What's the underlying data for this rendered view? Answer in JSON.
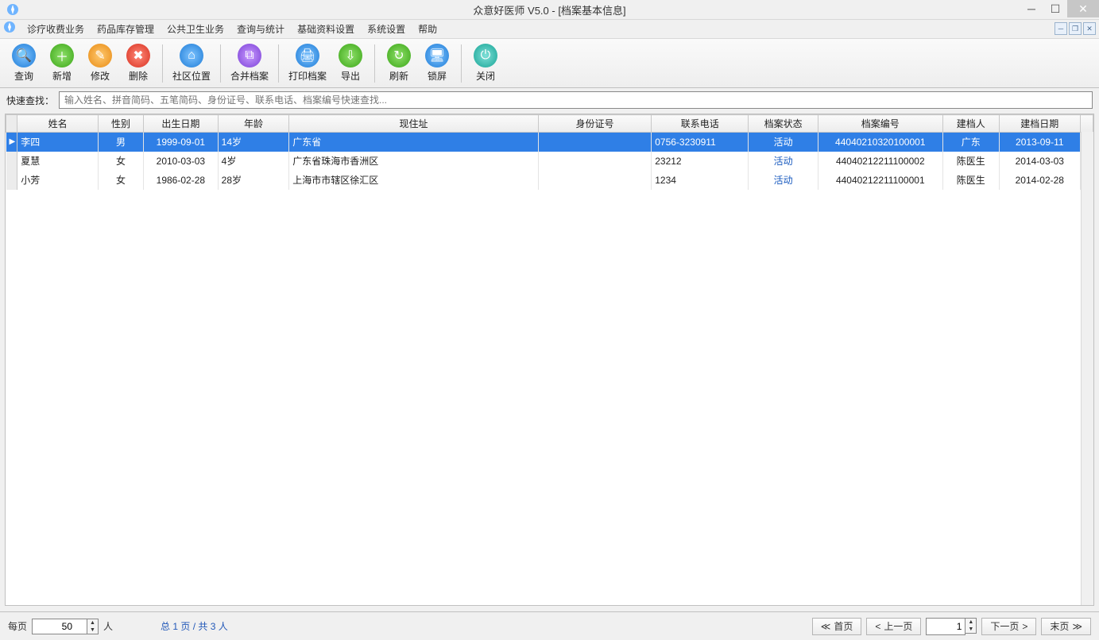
{
  "window": {
    "title": "众意好医师 V5.0 - [档案基本信息]"
  },
  "menu": {
    "items": [
      "诊疗收费业务",
      "药品库存管理",
      "公共卫生业务",
      "查询与统计",
      "基础资料设置",
      "系统设置",
      "帮助"
    ]
  },
  "toolbar": {
    "query": "查询",
    "add": "新增",
    "edit": "修改",
    "delete": "删除",
    "community": "社区位置",
    "merge": "合并档案",
    "print": "打印档案",
    "export": "导出",
    "refresh": "刷新",
    "lock": "锁屏",
    "close": "关闭"
  },
  "quick_search": {
    "label": "快速查找：",
    "placeholder": "输入姓名、拼音简码、五笔简码、身份证号、联系电话、档案编号快速查找..."
  },
  "table": {
    "headers": [
      "姓名",
      "性别",
      "出生日期",
      "年龄",
      "现住址",
      "身份证号",
      "联系电话",
      "档案状态",
      "档案编号",
      "建档人",
      "建档日期"
    ],
    "rows": [
      {
        "name": "李四",
        "gender": "男",
        "dob": "1999-09-01",
        "age": "14岁",
        "addr": "广东省",
        "idnum": "",
        "phone": "0756-3230911",
        "status": "活动",
        "fileNo": "44040210320100001",
        "creator": "广东",
        "cdate": "2013-09-11",
        "selected": true
      },
      {
        "name": "夏慧",
        "gender": "女",
        "dob": "2010-03-03",
        "age": "4岁",
        "addr": "广东省珠海市香洲区",
        "idnum": "",
        "phone": "23212",
        "status": "活动",
        "fileNo": "44040212211100002",
        "creator": "陈医生",
        "cdate": "2014-03-03",
        "selected": false
      },
      {
        "name": "小芳",
        "gender": "女",
        "dob": "1986-02-28",
        "age": "28岁",
        "addr": "上海市市辖区徐汇区",
        "idnum": "",
        "phone": "1234",
        "status": "活动",
        "fileNo": "44040212211100001",
        "creator": "陈医生",
        "cdate": "2014-02-28",
        "selected": false
      }
    ]
  },
  "footer": {
    "perPageLabel": "每页",
    "perPageValue": "50",
    "perPageUnit": "人",
    "summary": "总 1 页 / 共 3 人",
    "first": "首页",
    "prev": "上一页",
    "pageValue": "1",
    "next": "下一页",
    "last": "末页"
  }
}
